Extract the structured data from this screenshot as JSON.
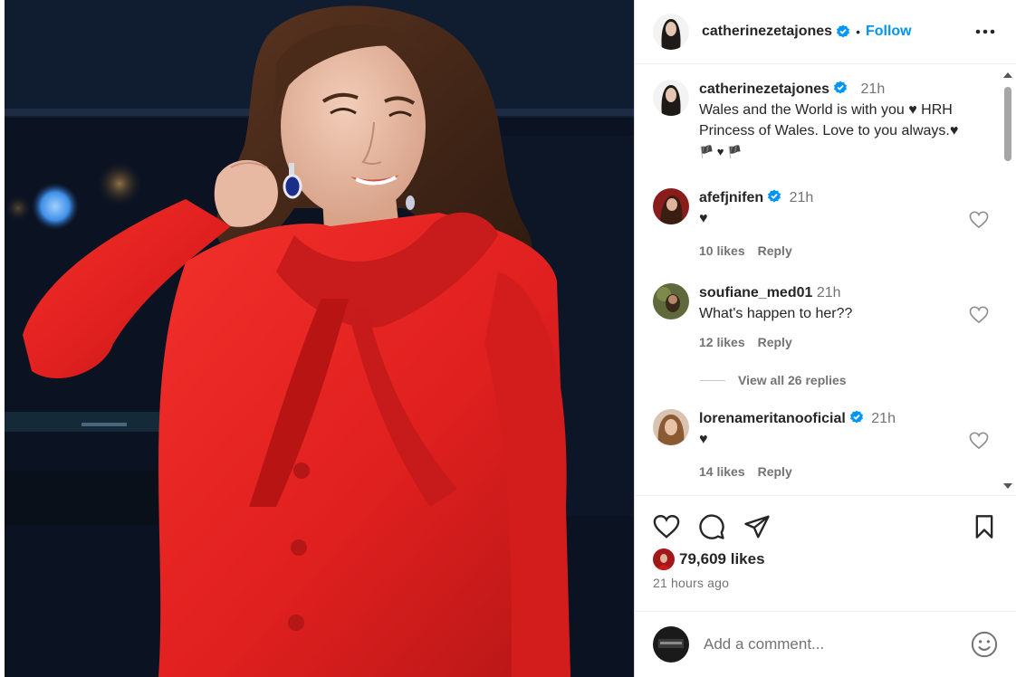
{
  "post": {
    "author": "catherinezetajones",
    "follow_label": "Follow",
    "separator": "•"
  },
  "caption": {
    "author": "catherinezetajones",
    "time": "21h",
    "line1": "Wales and the World is with you ♥ HRH",
    "line2": "Princess of Wales. Love to you always.♥",
    "line3": "🏴 ♥ 🏴"
  },
  "comments": [
    {
      "author": "afefjnifen",
      "verified": true,
      "time": "21h",
      "text": "♥",
      "likes": "10 likes",
      "reply": "Reply"
    },
    {
      "author": "soufiane_med01",
      "verified": false,
      "time": "21h",
      "text": "What's happen to her??",
      "likes": "12 likes",
      "reply": "Reply"
    },
    {
      "author": "lorenameritanooficial",
      "verified": true,
      "time": "21h",
      "text": "♥",
      "likes": "14 likes",
      "reply": "Reply"
    }
  ],
  "view_replies": "View all 26 replies",
  "likes": "79,609 likes",
  "posted": "21 hours ago",
  "add_comment": {
    "placeholder": "Add a comment..."
  },
  "icons": [
    "verified-badge-icon",
    "more-options-icon",
    "heart-icon",
    "comment-icon",
    "share-icon",
    "bookmark-icon",
    "emoji-icon"
  ],
  "colors": {
    "accent": "#0095f6",
    "coat": "#e0201f",
    "text": "#262626",
    "muted": "#737373"
  }
}
